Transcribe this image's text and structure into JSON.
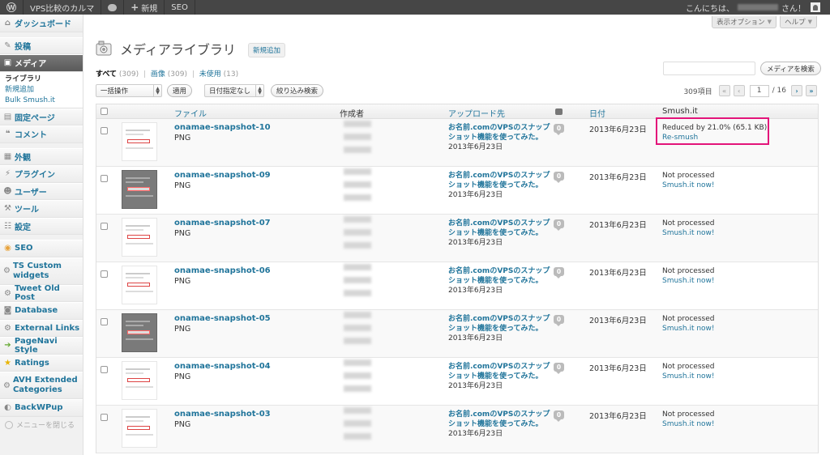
{
  "adminbar": {
    "site_name": "VPS比較のカルマ",
    "new_label": "新規",
    "seo_label": "SEO",
    "greeting_prefix": "こんにちは、",
    "greeting_suffix": "さん！"
  },
  "header": {
    "screen_options": "表示オプション",
    "help": "ヘルプ",
    "title": "メディアライブラリ",
    "add_new": "新規追加"
  },
  "sidebar": {
    "items": [
      {
        "label": "ダッシュボード"
      },
      {
        "label": "投稿"
      },
      {
        "label": "メディア"
      },
      {
        "label": "固定ページ"
      },
      {
        "label": "コメント"
      },
      {
        "label": "外観"
      },
      {
        "label": "プラグイン"
      },
      {
        "label": "ユーザー"
      },
      {
        "label": "ツール"
      },
      {
        "label": "設定"
      },
      {
        "label": "SEO"
      },
      {
        "label": "TS Custom widgets"
      },
      {
        "label": "Tweet Old Post"
      },
      {
        "label": "Database"
      },
      {
        "label": "External Links"
      },
      {
        "label": "PageNavi Style"
      },
      {
        "label": "Ratings"
      },
      {
        "label": "AVH Extended Categories"
      },
      {
        "label": "BackWPup"
      }
    ],
    "submenu": [
      "ライブラリ",
      "新規追加",
      "Bulk Smush.it"
    ],
    "collapse": "メニューを閉じる"
  },
  "filters": {
    "all": "すべて",
    "all_count": "(309)",
    "image": "画像",
    "image_count": "(309)",
    "unused": "未使用",
    "unused_count": "(13)"
  },
  "search": {
    "button": "メディアを検索",
    "value": ""
  },
  "tablenav": {
    "bulk_action": "一括操作",
    "apply": "適用",
    "date_filter": "日付指定なし",
    "filter_button": "絞り込み検索",
    "items_count": "309項目",
    "first": "«",
    "prev": "‹",
    "current_page": "1",
    "total_pages": "/ 16",
    "next": "›",
    "last": "»"
  },
  "table": {
    "headers": {
      "file": "ファイル",
      "author": "作成者",
      "uploaded_to": "アップロード先",
      "date": "日付",
      "smush": "Smush.it"
    },
    "rows": [
      {
        "name": "onamae-snapshot-10",
        "type": "PNG",
        "post": "お名前.comのVPSのスナップショット機能を使ってみた。",
        "post_date": "2013年6月23日",
        "comments": "0",
        "date": "2013年6月23日",
        "status": "Reduced by 21.0% (65.1 KB)",
        "action": "Re-smush",
        "thumb": "light"
      },
      {
        "name": "onamae-snapshot-09",
        "type": "PNG",
        "post": "お名前.comのVPSのスナップショット機能を使ってみた。",
        "post_date": "2013年6月23日",
        "comments": "0",
        "date": "2013年6月23日",
        "status": "Not processed",
        "action": "Smush.it now!",
        "thumb": "dark"
      },
      {
        "name": "onamae-snapshot-07",
        "type": "PNG",
        "post": "お名前.comのVPSのスナップショット機能を使ってみた。",
        "post_date": "2013年6月23日",
        "comments": "0",
        "date": "2013年6月23日",
        "status": "Not processed",
        "action": "Smush.it now!",
        "thumb": "light"
      },
      {
        "name": "onamae-snapshot-06",
        "type": "PNG",
        "post": "お名前.comのVPSのスナップショット機能を使ってみた。",
        "post_date": "2013年6月23日",
        "comments": "0",
        "date": "2013年6月23日",
        "status": "Not processed",
        "action": "Smush.it now!",
        "thumb": "light"
      },
      {
        "name": "onamae-snapshot-05",
        "type": "PNG",
        "post": "お名前.comのVPSのスナップショット機能を使ってみた。",
        "post_date": "2013年6月23日",
        "comments": "0",
        "date": "2013年6月23日",
        "status": "Not processed",
        "action": "Smush.it now!",
        "thumb": "dark"
      },
      {
        "name": "onamae-snapshot-04",
        "type": "PNG",
        "post": "お名前.comのVPSのスナップショット機能を使ってみた。",
        "post_date": "2013年6月23日",
        "comments": "0",
        "date": "2013年6月23日",
        "status": "Not processed",
        "action": "Smush.it now!",
        "thumb": "light"
      },
      {
        "name": "onamae-snapshot-03",
        "type": "PNG",
        "post": "お名前.comのVPSのスナップショット機能を使ってみた。",
        "post_date": "2013年6月23日",
        "comments": "0",
        "date": "2013年6月23日",
        "status": "Not processed",
        "action": "Smush.it now!",
        "thumb": "light"
      }
    ]
  },
  "colors": {
    "link": "#21759b",
    "highlight": "#e3147a",
    "adminbar": "#464646"
  }
}
